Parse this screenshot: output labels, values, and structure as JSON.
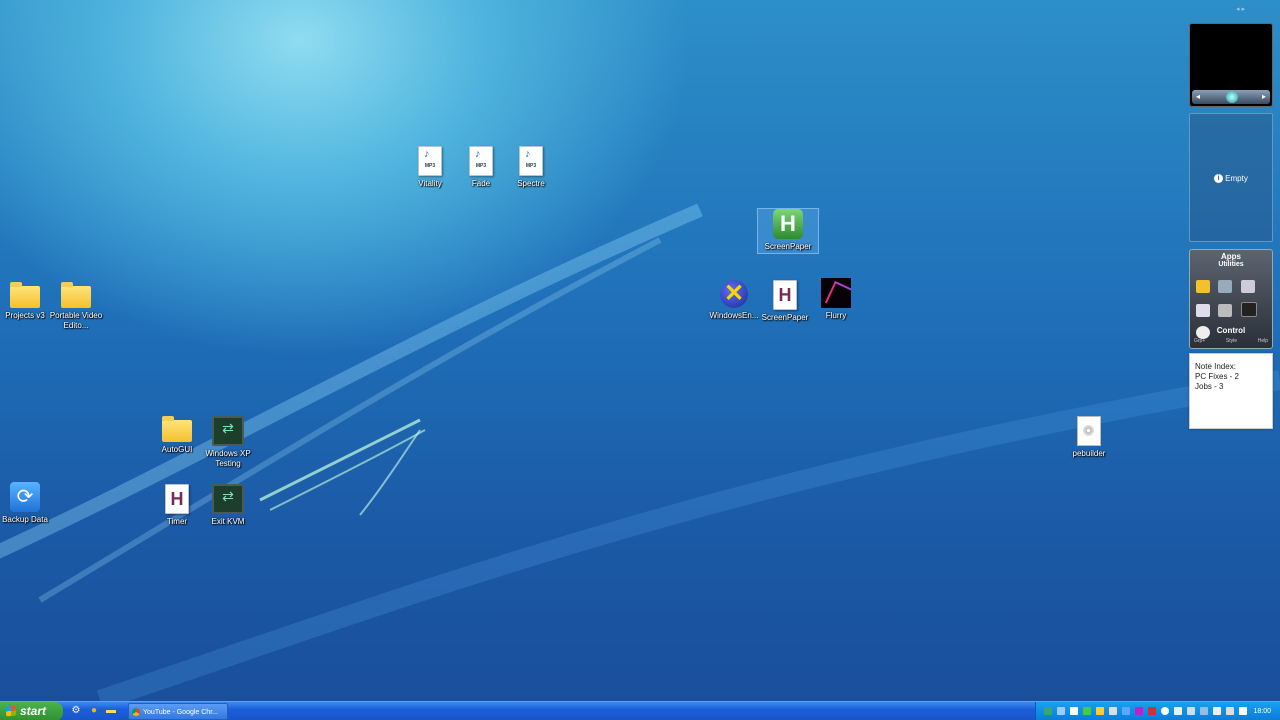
{
  "desktop": {
    "icons": {
      "vitality": {
        "label": "Vitality",
        "type_label": "MP3"
      },
      "fade": {
        "label": "Fade",
        "type_label": "MP3"
      },
      "spectre": {
        "label": "Spectre",
        "type_label": "MP3"
      },
      "screenpaper_selected": {
        "label": "ScreenPaper"
      },
      "windowsen": {
        "label": "WindowsEn..."
      },
      "screenpaper": {
        "label": "ScreenPaper"
      },
      "flurry": {
        "label": "Flurry"
      },
      "projects": {
        "label": "Projects v3"
      },
      "portable": {
        "label": "Portable Video Edito..."
      },
      "autogui": {
        "label": "AutoGUI"
      },
      "winxp": {
        "label": "Windows XP Testing"
      },
      "backup": {
        "label": "Backup Data"
      },
      "timer": {
        "label": "Timer"
      },
      "exitkvm": {
        "label": "Exit KVM"
      },
      "pebuilder": {
        "label": "pebuilder"
      }
    }
  },
  "sidebar": {
    "empty_gadget": {
      "text": "Empty"
    },
    "apps_gadget": {
      "title": "Apps",
      "subtitle": "Utilities",
      "control": "Control",
      "sub_links": [
        "Grp+",
        "Style",
        "Help"
      ]
    },
    "notes": {
      "lines": [
        "Note Index:",
        "PC Fixes - 2",
        "Jobs - 3"
      ]
    }
  },
  "taskbar": {
    "start_label": "start",
    "window_title": "YouTube - Google Chr...",
    "clock": "18:00"
  },
  "colors": {
    "taskbar_blue": "#1c5ed8",
    "start_green": "#3a9f3a",
    "tray_blue": "#0b7ad8"
  }
}
